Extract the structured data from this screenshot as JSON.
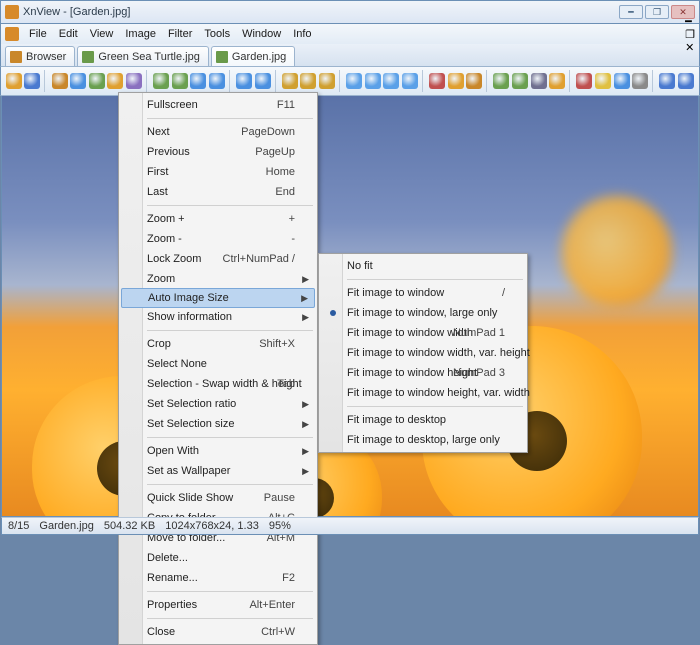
{
  "title": "XnView - [Garden.jpg]",
  "menus": [
    "File",
    "Edit",
    "View",
    "Image",
    "Filter",
    "Tools",
    "Window",
    "Info"
  ],
  "tabs": [
    {
      "label": "Browser",
      "type": "browser"
    },
    {
      "label": "Green Sea Turtle.jpg",
      "type": "img"
    },
    {
      "label": "Garden.jpg",
      "type": "img",
      "active": true
    }
  ],
  "context_menu": {
    "groups": [
      [
        {
          "label": "Fullscreen",
          "kb": "F11"
        }
      ],
      [
        {
          "label": "Next",
          "kb": "PageDown"
        },
        {
          "label": "Previous",
          "kb": "PageUp"
        },
        {
          "label": "First",
          "kb": "Home"
        },
        {
          "label": "Last",
          "kb": "End"
        }
      ],
      [
        {
          "label": "Zoom +",
          "kb": "+"
        },
        {
          "label": "Zoom -",
          "kb": "-"
        },
        {
          "label": "Lock Zoom",
          "kb": "Ctrl+NumPad /"
        },
        {
          "label": "Zoom",
          "sub": true
        },
        {
          "label": "Auto Image Size",
          "sub": true,
          "highlight": true
        },
        {
          "label": "Show information",
          "sub": true
        }
      ],
      [
        {
          "label": "Crop",
          "kb": "Shift+X"
        },
        {
          "label": "Select None"
        },
        {
          "label": "Selection - Swap width & height",
          "kb": "Tab"
        },
        {
          "label": "Set Selection ratio",
          "sub": true
        },
        {
          "label": "Set Selection size",
          "sub": true
        }
      ],
      [
        {
          "label": "Open With",
          "sub": true
        },
        {
          "label": "Set as Wallpaper",
          "sub": true
        }
      ],
      [
        {
          "label": "Quick Slide Show",
          "kb": "Pause"
        },
        {
          "label": "Copy to folder...",
          "kb": "Alt+C"
        },
        {
          "label": "Move to folder...",
          "kb": "Alt+M"
        },
        {
          "label": "Delete..."
        },
        {
          "label": "Rename...",
          "kb": "F2"
        }
      ],
      [
        {
          "label": "Properties",
          "kb": "Alt+Enter"
        }
      ],
      [
        {
          "label": "Close",
          "kb": "Ctrl+W"
        }
      ]
    ]
  },
  "submenu": {
    "groups": [
      [
        {
          "label": "No fit"
        }
      ],
      [
        {
          "label": "Fit image to window",
          "kb": "/"
        },
        {
          "label": "Fit image to window, large only",
          "selected": true
        },
        {
          "label": "Fit image to window width",
          "kb": "NumPad 1"
        },
        {
          "label": "Fit image to window width, var. height"
        },
        {
          "label": "Fit image to window height",
          "kb": "NumPad 3"
        },
        {
          "label": "Fit image to window height, var. width"
        }
      ],
      [
        {
          "label": "Fit image to desktop"
        },
        {
          "label": "Fit image to desktop, large only"
        }
      ]
    ]
  },
  "status": {
    "index": "8/15",
    "file": "Garden.jpg",
    "size": "504.32 KB",
    "dims": "1024x768x24, 1.33",
    "zoom": "95%"
  },
  "toolbar_icons": [
    "open",
    "save",
    "sep",
    "browser",
    "fullscreen",
    "hex",
    "slideshow",
    "convert",
    "sep",
    "rotate-ccw",
    "rotate-cw",
    "flip-h",
    "flip-v",
    "sep",
    "undo",
    "redo",
    "sep",
    "zoom-in",
    "zoom-fit",
    "zoom-out",
    "sep",
    "prev-page",
    "prev",
    "next",
    "next-page",
    "sep",
    "cut",
    "copy",
    "paste",
    "sep",
    "acquire",
    "scan",
    "print",
    "clipboard",
    "sep",
    "delete",
    "email",
    "web",
    "options",
    "sep",
    "help",
    "about"
  ],
  "icon_colors": {
    "open": "#e0a030",
    "save": "#4a7ad0",
    "browser": "#c9872a",
    "fullscreen": "#4a90e0",
    "hex": "#6aa050",
    "slideshow": "#e0a030",
    "convert": "#8a70c0",
    "rotate-ccw": "#6aa050",
    "rotate-cw": "#6aa050",
    "flip-h": "#4a90e0",
    "flip-v": "#4a90e0",
    "undo": "#4a90e0",
    "redo": "#4a90e0",
    "zoom-in": "#d0a030",
    "zoom-fit": "#d0a030",
    "zoom-out": "#d0a030",
    "prev-page": "#5aa0e8",
    "prev": "#5aa0e8",
    "next": "#5aa0e8",
    "next-page": "#5aa0e8",
    "cut": "#c05050",
    "copy": "#e0a030",
    "paste": "#c9872a",
    "acquire": "#6aa050",
    "scan": "#6aa050",
    "print": "#707090",
    "clipboard": "#e0a030",
    "delete": "#c05050",
    "email": "#e0c040",
    "web": "#4a90e0",
    "options": "#8a8a8a",
    "help": "#4a7ad0",
    "about": "#4a7ad0"
  }
}
